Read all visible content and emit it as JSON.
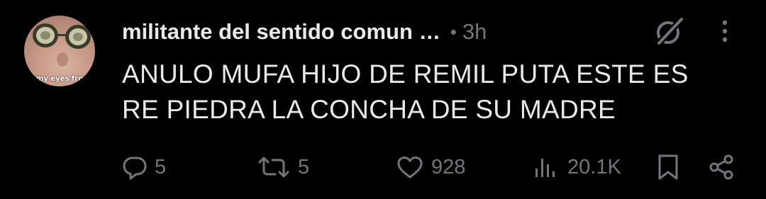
{
  "post": {
    "author_name": "militante del sentido comun",
    "truncation": "...",
    "separator": "•",
    "time": "3h",
    "text_line1": "ANULO MUFA HIJO DE REMIL PUTA ESTE ES",
    "text_line2": "RE PIEDRA LA CONCHA DE SU MADRE",
    "avatar_caption": "ect my eyes from"
  },
  "actions": {
    "replies": "5",
    "reposts": "5",
    "likes": "928",
    "views": "20.1K"
  },
  "icons": {
    "reply": "reply-icon",
    "repost": "repost-icon",
    "like": "heart-icon",
    "views": "views-icon",
    "bookmark": "bookmark-icon",
    "share": "share-icon",
    "grok": "grok-icon",
    "more": "more-icon"
  },
  "colors": {
    "background": "#000000",
    "text": "#e7e9ea",
    "secondary": "#71767b"
  }
}
